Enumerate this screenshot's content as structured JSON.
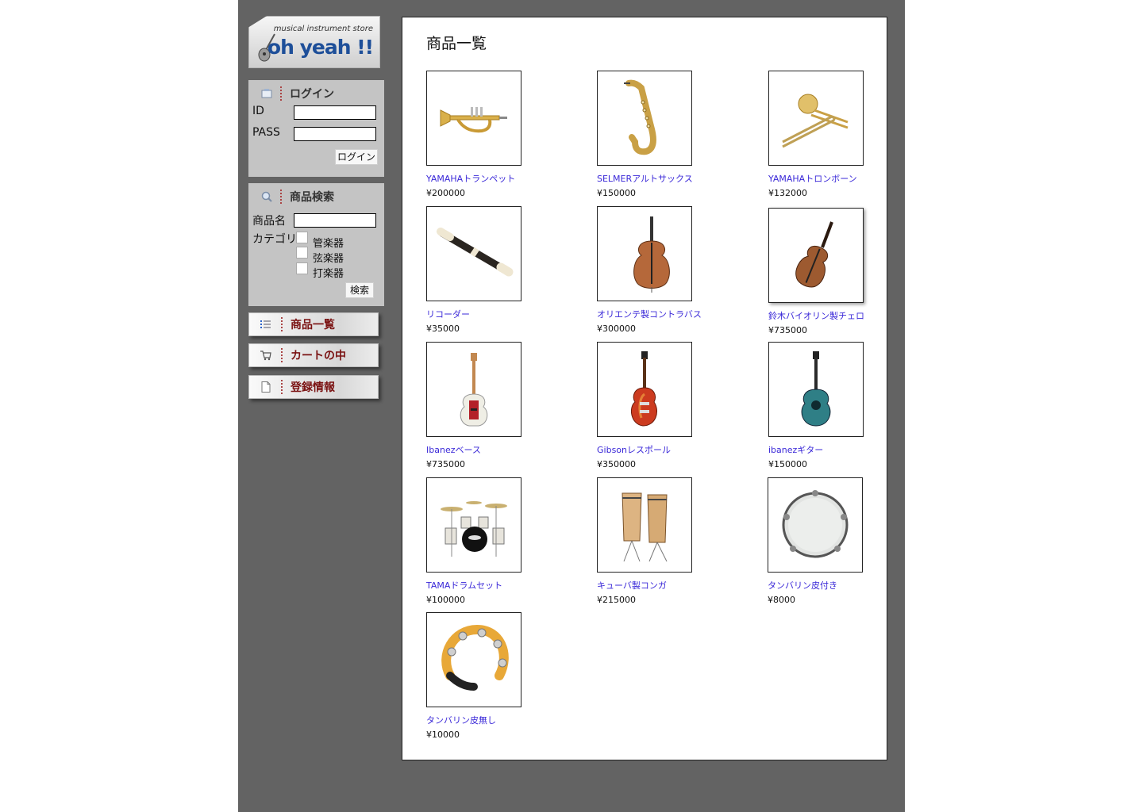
{
  "logo": {
    "tagline": "musical instrument store",
    "brand": "oh yeah !!"
  },
  "login": {
    "title": "ログイン",
    "id_label": "ID",
    "pass_label": "PASS",
    "button": "ログイン"
  },
  "search": {
    "title": "商品検索",
    "name_label": "商品名",
    "category_label": "カテゴリ",
    "categories": [
      "管楽器",
      "弦楽器",
      "打楽器"
    ],
    "button": "検索"
  },
  "nav": [
    {
      "label": "商品一覧",
      "icon": "list-icon"
    },
    {
      "label": "カートの中",
      "icon": "cart-icon"
    },
    {
      "label": "登録情報",
      "icon": "document-icon"
    }
  ],
  "main": {
    "title": "商品一覧"
  },
  "products": [
    {
      "name": "YAMAHAトランペット",
      "price": "¥200000",
      "icon": "trumpet"
    },
    {
      "name": "SELMERアルトサックス",
      "price": "¥150000",
      "icon": "saxophone"
    },
    {
      "name": "YAMAHAトロンボーン",
      "price": "¥132000",
      "icon": "trombone"
    },
    {
      "name": "リコーダー",
      "price": "¥35000",
      "icon": "recorder"
    },
    {
      "name": "オリエンテ製コントラバス",
      "price": "¥300000",
      "icon": "contrabass"
    },
    {
      "name": "鈴木バイオリン製チェロ",
      "price": "¥735000",
      "icon": "cello"
    },
    {
      "name": "Ibanezベース",
      "price": "¥735000",
      "icon": "bass-guitar"
    },
    {
      "name": "Gibsonレスポール",
      "price": "¥350000",
      "icon": "les-paul"
    },
    {
      "name": "ibanezギター",
      "price": "¥150000",
      "icon": "acoustic-guitar"
    },
    {
      "name": "TAMAドラムセット",
      "price": "¥100000",
      "icon": "drum-set"
    },
    {
      "name": "キューバ製コンガ",
      "price": "¥215000",
      "icon": "conga"
    },
    {
      "name": "タンバリン皮付き",
      "price": "¥8000",
      "icon": "tambourine"
    },
    {
      "name": "タンバリン皮無し",
      "price": "¥10000",
      "icon": "tambourine-ring"
    }
  ],
  "colors": {
    "frame": "#636363",
    "panel": "#c4c4c4",
    "link": "#3a28d8",
    "nav_text": "#7a1212"
  }
}
